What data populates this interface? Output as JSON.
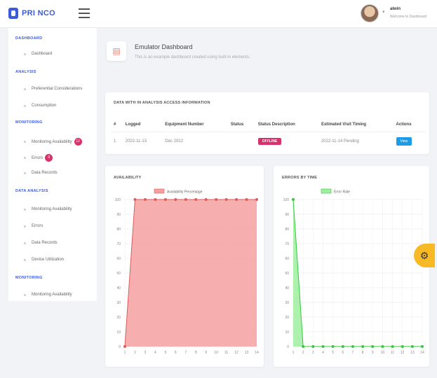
{
  "app": {
    "logo_text": "PRI NCO"
  },
  "user": {
    "name": "alwin",
    "role": "Welcome to Dashboard"
  },
  "sidebar": {
    "sections": [
      {
        "label": "DASHBOARD",
        "items": [
          {
            "label": "Dashboard"
          }
        ]
      },
      {
        "label": "ANALYSIS",
        "items": [
          {
            "label": "Preferential Considerations"
          },
          {
            "label": "Consumption"
          }
        ]
      },
      {
        "label": "MONITORING",
        "items": [
          {
            "label": "Monitoring Availability",
            "badge": "12"
          },
          {
            "label": "Errors",
            "badge": "0"
          },
          {
            "label": "Data Records"
          }
        ]
      },
      {
        "label": "DATA ANALYSIS",
        "items": [
          {
            "label": "Monitoring Availability"
          },
          {
            "label": "Errors"
          },
          {
            "label": "Data Records"
          },
          {
            "label": "Device Utilization"
          }
        ]
      },
      {
        "label": "MONITORING",
        "items": [
          {
            "label": "Monitoring Availability"
          }
        ]
      }
    ]
  },
  "header": {
    "icon": "dashboard-icon",
    "title": "Emulator Dashboard",
    "subtitle": "This is an example dashboard created using built-in elements."
  },
  "table": {
    "title": "DATA WITH IN ANALYSIS ACCESS INFORMATION",
    "columns": [
      "#",
      "Logged",
      "Equipment Number",
      "Status",
      "Status Description",
      "Estimated Visit Timing",
      "Actions"
    ],
    "rows": [
      {
        "num": "1",
        "logged": "2022-11-13",
        "equipment": "Dec 2022",
        "status": "",
        "status_description": "OFFLINE",
        "visit": "2022-11-14 Pending",
        "action": "View"
      }
    ]
  },
  "charts": {
    "availability": {
      "title": "AVAILABILITY",
      "legend": "Availability Percentage",
      "color": "#f4a0a0",
      "stroke": "#e05b5b"
    },
    "errors": {
      "title": "ERRORS BY TIME",
      "legend": "Error Rate",
      "color": "#9ef0a0",
      "stroke": "#35c93c"
    }
  },
  "chart_data": [
    {
      "type": "area",
      "title": "AVAILABILITY",
      "series": [
        {
          "name": "Availability Percentage",
          "values": [
            0,
            100,
            100,
            100,
            100,
            100,
            100,
            100,
            100,
            100,
            100,
            100,
            100,
            100
          ]
        }
      ],
      "x": [
        "1",
        "2",
        "3",
        "4",
        "5",
        "6",
        "7",
        "8",
        "9",
        "10",
        "11",
        "12",
        "13",
        "14"
      ],
      "ylim": [
        0,
        100
      ],
      "yticks": [
        "0",
        "10",
        "20",
        "30",
        "40",
        "50",
        "60",
        "70",
        "80",
        "90",
        "100"
      ],
      "grid": true,
      "legend_position": "top"
    },
    {
      "type": "area",
      "title": "ERRORS BY TIME",
      "series": [
        {
          "name": "Error Rate",
          "values": [
            100,
            0,
            0,
            0,
            0,
            0,
            0,
            0,
            0,
            0,
            0,
            0,
            0,
            0
          ]
        }
      ],
      "x": [
        "1",
        "2",
        "3",
        "4",
        "5",
        "6",
        "7",
        "8",
        "9",
        "10",
        "11",
        "12",
        "13",
        "14"
      ],
      "ylim": [
        0,
        100
      ],
      "yticks": [
        "0",
        "10",
        "20",
        "30",
        "40",
        "50",
        "60",
        "70",
        "80",
        "90",
        "100"
      ],
      "grid": true,
      "legend_position": "top"
    }
  ]
}
